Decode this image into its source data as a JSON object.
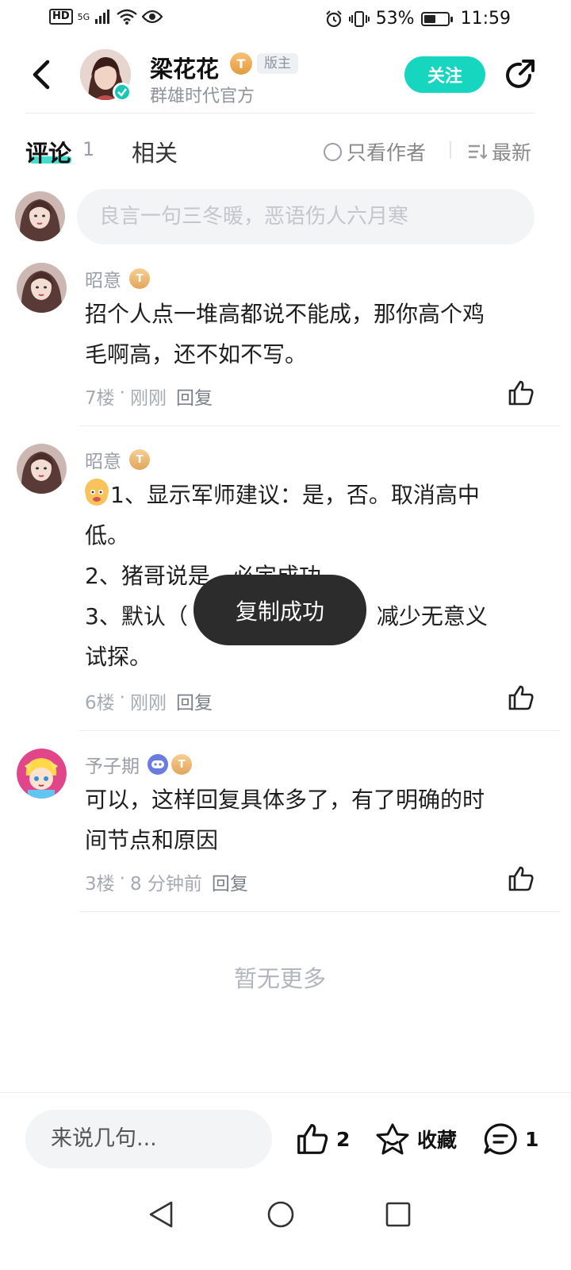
{
  "status_bar": {
    "hd": "HD",
    "network": "5G",
    "battery_pct": "53%",
    "battery_level": 0.53,
    "time": "11:59"
  },
  "header": {
    "author_name": "梁花花",
    "level_badge": "T",
    "moderator_tag": "版主",
    "subtitle": "群雄时代官方",
    "follow_label": "关注"
  },
  "tabs": {
    "comments_label": "评论",
    "comments_count": "1",
    "related_label": "相关",
    "only_author_label": "只看作者",
    "sort_label": "最新"
  },
  "comment_input": {
    "placeholder": "良言一句三冬暖，恶语伤人六月寒"
  },
  "comments": [
    {
      "user": "昭意",
      "badge": "T",
      "lines": [
        "招个人点一堆高都说不能成，那你高个鸡",
        "毛啊高，还不如不写。"
      ],
      "floor": "7楼",
      "time": "刚刚",
      "reply": "回复"
    },
    {
      "user": "昭意",
      "badge": "T",
      "lines": [
        "1、显示军师建议：是，否。取消高中",
        "低。",
        "2、猪哥说是，必定成功。",
        "3、默认（　　　　　　　），减少无意义",
        "试探。"
      ],
      "floor": "6楼",
      "time": "刚刚",
      "reply": "回复"
    },
    {
      "user": "予子期",
      "badge": "T",
      "lines": [
        "可以，这样回复具体多了，有了明确的时",
        "间节点和原因"
      ],
      "floor": "3楼",
      "time": "8 分钟前",
      "reply": "回复"
    }
  ],
  "meta_sep": "·",
  "no_more": "暂无更多",
  "toast": "复制成功",
  "bottom_bar": {
    "say_placeholder": "来说几句...",
    "like_count": "2",
    "favorite_label": "收藏",
    "comment_count": "1"
  },
  "colors": {
    "accent": "#16d6c0",
    "toast_bg": "#2c2c2c"
  },
  "icons": [
    "back-icon",
    "share-icon",
    "like-icon",
    "star-icon",
    "comment-icon",
    "nav-back-icon",
    "nav-home-icon",
    "nav-recent-icon"
  ]
}
